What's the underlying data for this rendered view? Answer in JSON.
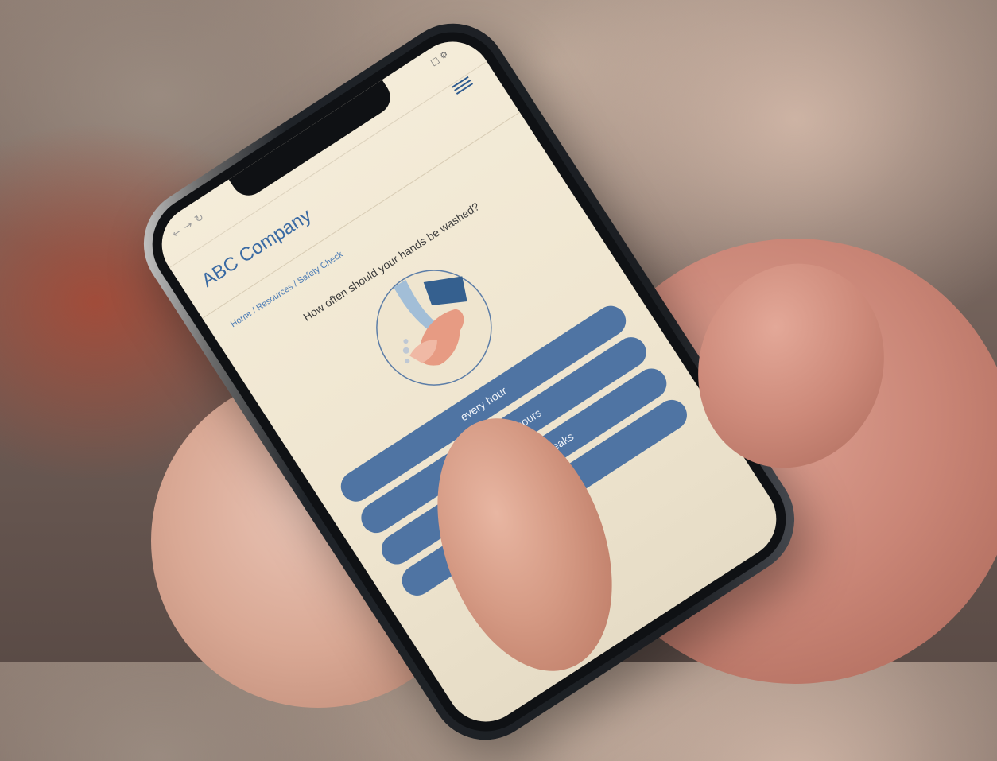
{
  "site": {
    "brand": "ABC Company",
    "menu_icon": "hamburger-icon",
    "browser_icons": [
      "back-icon",
      "forward-icon",
      "reload-icon"
    ]
  },
  "breadcrumb": {
    "home": "Home",
    "resources": "Resources",
    "current": "Safety Check",
    "separator": " / "
  },
  "quiz": {
    "question": "How often should your hands be washed?",
    "illustration": "hand-washing-icon",
    "answers": [
      {
        "label": "every hour"
      },
      {
        "label": "every three hours"
      },
      {
        "label": "before and after breaks"
      },
      {
        "label": ""
      }
    ]
  },
  "colors": {
    "brand_blue": "#3a6aa3",
    "button_blue": "#4f74a3",
    "screen_bg": "#f4ecd9"
  }
}
